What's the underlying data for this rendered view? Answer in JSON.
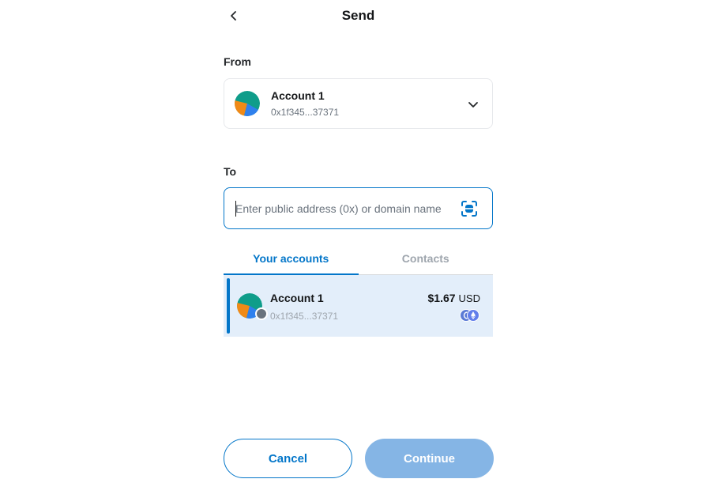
{
  "header": {
    "title": "Send",
    "back_icon": "chevron-left-icon"
  },
  "from": {
    "label": "From",
    "account_name": "Account 1",
    "account_address": "0x1f345...37371"
  },
  "to": {
    "label": "To",
    "placeholder": "Enter public address (0x) or domain name",
    "value": "",
    "scan_icon": "qr-scan-icon"
  },
  "tabs": [
    {
      "label": "Your accounts",
      "active": true
    },
    {
      "label": "Contacts",
      "active": false
    }
  ],
  "accounts": [
    {
      "name": "Account 1",
      "address": "0x1f345...37371",
      "balance": "$1.67",
      "currency": "USD"
    }
  ],
  "buttons": {
    "cancel": "Cancel",
    "continue": "Continue"
  },
  "colors": {
    "primary": "#0376c9",
    "primary_disabled": "#85b5e5",
    "selected_row": "#e3eefa",
    "avatar_teal": "#0f9d8a",
    "avatar_orange": "#f08a17",
    "avatar_blue": "#2f80ed"
  }
}
